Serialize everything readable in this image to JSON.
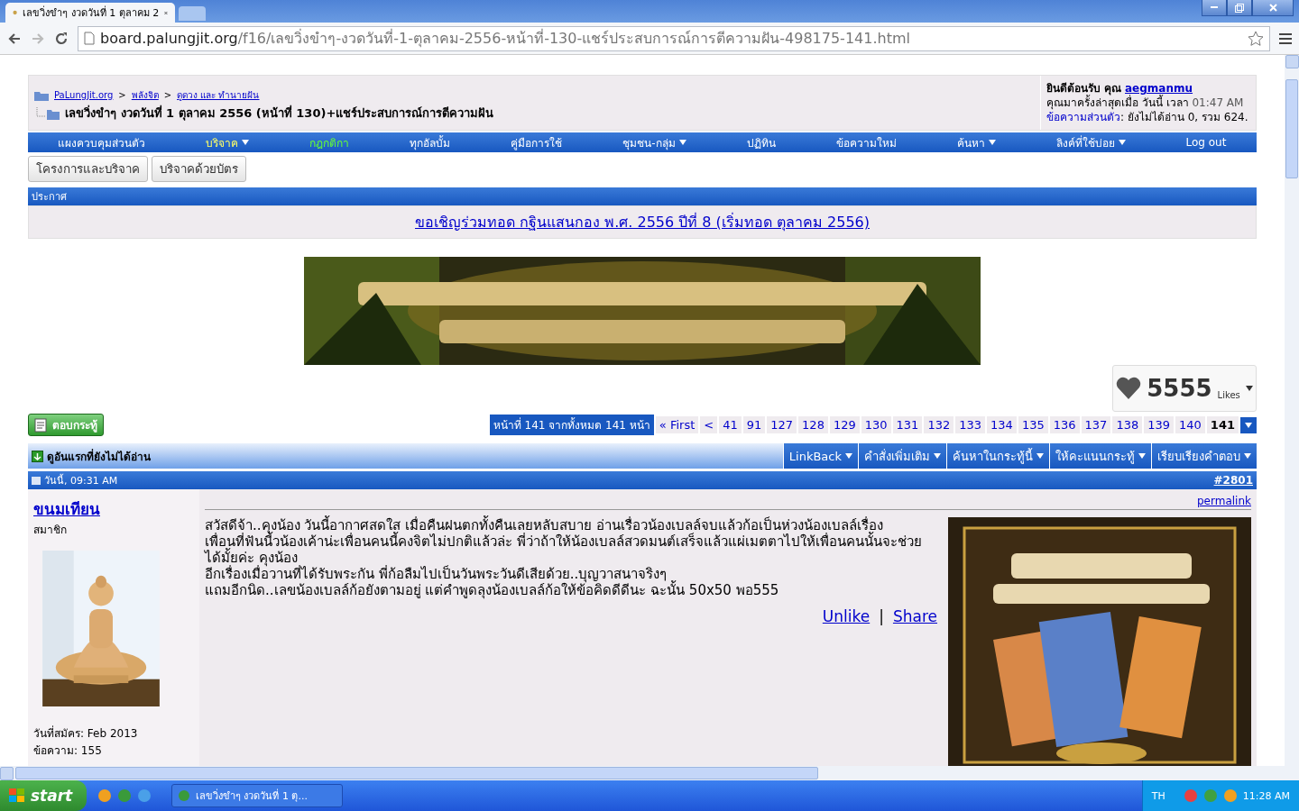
{
  "browser": {
    "tabs": [
      {
        "title": "เลขวิ่งขำๆ งวดวันที่ 1 ตุลาคม 2",
        "selected": true
      }
    ],
    "address": {
      "host": "board.palungjit.org",
      "path": "/f16/เลขวิ่งขำๆ-งวดวันที่-1-ตุลาคม-2556-หน้าที่-130-แชร์ประสบการณ์การตีความฝัน-498175-141.html"
    }
  },
  "breadcrumb": {
    "links": [
      "PaLungJit.org",
      "พลังจิต",
      "ดูดวง และ ทำนายฝัน"
    ],
    "separator": ">",
    "title": "เลขวิ่งขำๆ งวดวันที่ 1 ตุลาคม 2556 (หน้าที่ 130)+แชร์ประสบการณ์การตีความฝัน"
  },
  "welcome": {
    "greeting": "ยินดีต้อนรับ คุณ",
    "username": "aegmanmu",
    "last_visit": "คุณมาครั้งล่าสุดเมื่อ วันนี้ เวลา",
    "time": "01:47 AM",
    "pm_link": "ข้อความส่วนตัว",
    "pm_text": ": ยังไม่ได้อ่าน 0, รวม 624."
  },
  "navbar": [
    {
      "label": "แผงควบคุมส่วนตัว",
      "dropdown": false,
      "kind": "plain"
    },
    {
      "label": "บริจาค",
      "dropdown": true,
      "kind": "donate"
    },
    {
      "label": "กฎกติกา",
      "dropdown": false,
      "kind": "rules"
    },
    {
      "label": "ทุกอัลบั้ม",
      "dropdown": false,
      "kind": "plain"
    },
    {
      "label": "คู่มือการใช้",
      "dropdown": false,
      "kind": "plain"
    },
    {
      "label": "ชุมชน-กลุ่ม",
      "dropdown": true,
      "kind": "plain"
    },
    {
      "label": "ปฏิทิน",
      "dropdown": false,
      "kind": "plain"
    },
    {
      "label": "ข้อความใหม่",
      "dropdown": false,
      "kind": "plain"
    },
    {
      "label": "ค้นหา",
      "dropdown": true,
      "kind": "plain"
    },
    {
      "label": "ลิงค์ที่ใช้บ่อย",
      "dropdown": true,
      "kind": "plain"
    },
    {
      "label": "Log out",
      "dropdown": false,
      "kind": "plain"
    }
  ],
  "sub_buttons": [
    "โครงการและบริจาค",
    "บริจาคด้วยบัตร"
  ],
  "announcement": {
    "heading": "ประกาศ",
    "link": "ขอเชิญร่วมทอด กฐินแสนกอง พ.ศ. 2556 ปีที่ 8 (เริ่มทอด ตุลาคม 2556)"
  },
  "banner": {
    "kind": "picture"
  },
  "likes": {
    "count": "5555",
    "label": "Likes"
  },
  "reply_button": "ตอบกระทู้",
  "pagination": {
    "summary": "หน้าที่ 141 จากทั้งหมด 141 หน้า",
    "first": "« First",
    "prev": "<",
    "pages": [
      {
        "label": "41",
        "selected": false
      },
      {
        "label": "91",
        "selected": false
      },
      {
        "label": "127",
        "selected": false
      },
      {
        "label": "128",
        "selected": false
      },
      {
        "label": "129",
        "selected": false
      },
      {
        "label": "130",
        "selected": false
      },
      {
        "label": "131",
        "selected": false
      },
      {
        "label": "132",
        "selected": false
      },
      {
        "label": "133",
        "selected": false
      },
      {
        "label": "134",
        "selected": false
      },
      {
        "label": "135",
        "selected": false
      },
      {
        "label": "136",
        "selected": false
      },
      {
        "label": "137",
        "selected": false
      },
      {
        "label": "138",
        "selected": false
      },
      {
        "label": "139",
        "selected": false
      },
      {
        "label": "140",
        "selected": false
      },
      {
        "label": "141",
        "selected": true
      }
    ]
  },
  "thread_bar": {
    "unread": "ดูอันแรกที่ยังไม่ได้อ่าน",
    "tools": [
      "LinkBack",
      "คำสั่งเพิ่มเติม",
      "ค้นหาในกระทู้นี้",
      "ให้คะแนนกระทู้",
      "เรียบเรียงคำตอบ"
    ]
  },
  "post": {
    "date": "วันนี้, 09:31 AM",
    "number": "#2801",
    "author": "ขนมเทียน",
    "role": "สมาชิก",
    "joined": "วันที่สมัคร: Feb 2013",
    "posts": "ข้อความ: 155",
    "permalink": "permalink",
    "lines": [
      "สวัสดีจ้า..คุงน้อง วันนี้อากาศสดใส เมื่อคืนฝนตกทั้งคืนเลยหลับสบาย อ่านเรื่อวน้องเบลล์จบแล้วก้อเป็นห่วงน้องเบลล์เรื่อง",
      "เพื่อนที่ฟันนี้วน้องเค้าน่ะเพื่อนคนนี้คงจิตไม่ปกติแล้วล่ะ พี่ว่าถ้าให้น้องเบลล์สวดมนต์เสร็จแล้วแผ่เมตตาไปให้เพื่อนคนนั้นจะช่วย",
      "ได้มั้ยค่ะ คุงน้อง",
      "อีกเรื่องเมื่อวานที่ได้รับพระกัน พี่ก้อลืมไปเป็นวันพระวันดีเสียด้วย..บุญวาสนาจริงๆ",
      "แถมอีกนิด..เลขน้องเบลล์ก้อยังตามอยู่ แต่คำพูดลุงน้องเบลล์ก้อให้ข้อคิดดีดีนะ ฉะนั้น 50x50 พอ555"
    ],
    "actions": [
      "Unlike",
      "Share"
    ],
    "action_divider": "|"
  },
  "taskbar": {
    "start": "start",
    "task": "เลขวิ่งขำๆ งวดวันที่ 1 ตุ...",
    "lang": "TH",
    "clock": "11:28 AM"
  }
}
